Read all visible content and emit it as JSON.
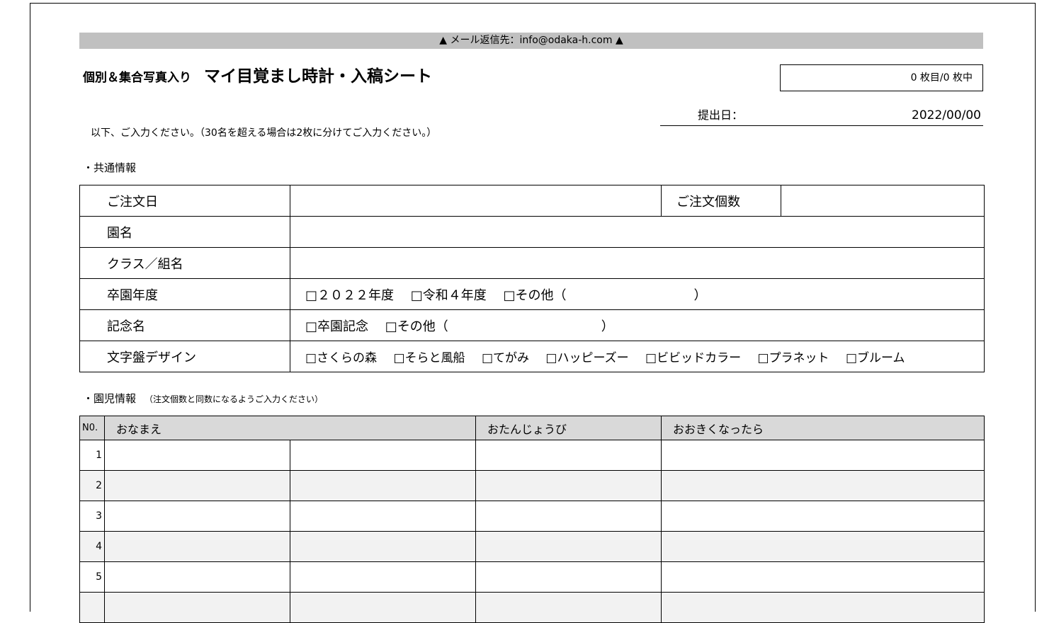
{
  "banner": "▲ メール返信先：info@odaka-h.com ▲",
  "title": {
    "small": "個別＆集合写真入り",
    "main": "マイ目覚まし時計・入稿シート"
  },
  "page_counter": "0 枚目/0 枚中",
  "submission": {
    "label": "提出日：",
    "value": "2022/00/00"
  },
  "instructions": "以下、ご入力ください。（30名を超える場合は2枚に分けてご入力ください。）",
  "common_section": {
    "heading": "・共通情報",
    "order_date_label": "ご注文日",
    "order_qty_label": "ご注文個数",
    "school_label": "園名",
    "class_label": "クラス／組名",
    "year_label": "卒園年度",
    "year_options": [
      "□２０２２年度",
      "□令和４年度",
      "□その他（　　　　　　　　　　）"
    ],
    "memorial_label": "記念名",
    "memorial_options": [
      "□卒園記念",
      "□その他（　　　　　　　　　　　　）"
    ],
    "dial_label": "文字盤デザイン",
    "dial_options": [
      "□さくらの森",
      "□そらと風船",
      "□てがみ",
      "□ハッピーズー",
      "□ビビッドカラー",
      "□プラネット",
      "□ブルーム"
    ]
  },
  "children_section": {
    "heading": "・園児情報",
    "note": "（注文個数と同数になるようご入力ください）",
    "columns": [
      "N0.",
      "おなまえ",
      "おたんじょうび",
      "おおきくなったら"
    ],
    "rows": [
      "1",
      "2",
      "3",
      "4",
      "5",
      ""
    ]
  }
}
